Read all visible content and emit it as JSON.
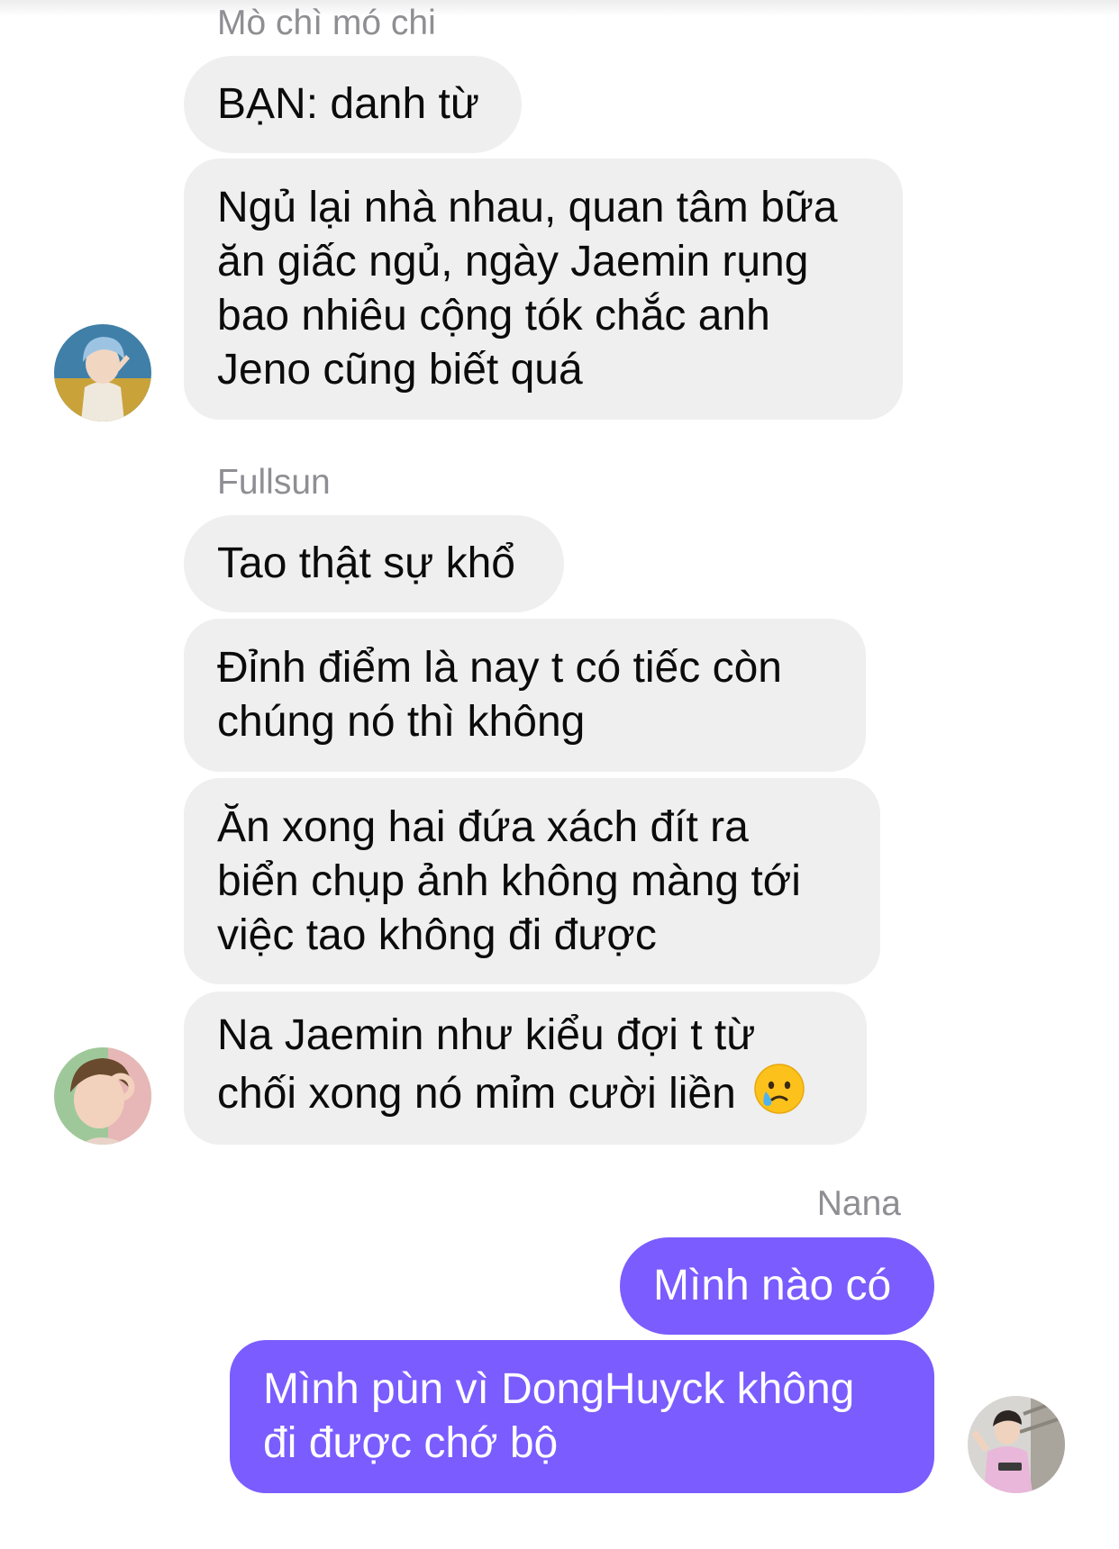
{
  "conversation": {
    "groups": [
      {
        "sender": "Mò chì mó chi",
        "messages": [
          {
            "lines": [
              "BẠN: danh từ"
            ]
          },
          {
            "lines": [
              "Ngủ lại nhà nhau, quan tâm bữa",
              "ăn giấc ngủ, ngày Jaemin rụng",
              "bao nhiêu cộng tók chắc anh",
              "Jeno cũng biết quá"
            ]
          }
        ]
      },
      {
        "sender": "Fullsun",
        "messages": [
          {
            "lines": [
              "Tao thật sự khổ"
            ]
          },
          {
            "lines": [
              "Đỉnh điểm là nay t có tiếc còn",
              "chúng nó thì không"
            ]
          },
          {
            "lines": [
              "Ăn xong hai đứa xách đít ra",
              "biển chụp ảnh không màng tới",
              "việc tao không đi được"
            ]
          },
          {
            "lines": [
              "Na Jaemin như kiểu đợi t từ",
              "chối xong nó mỉm cười liền"
            ],
            "emoji": "crying-face"
          }
        ]
      },
      {
        "sender": "Nana",
        "messages": [
          {
            "lines": [
              "Mình nào có"
            ]
          },
          {
            "lines": [
              "Mình pùn vì DongHuyck không",
              "đi được chớ bộ"
            ]
          }
        ]
      }
    ]
  },
  "colors": {
    "incoming_bubble": "#efefef",
    "outgoing_bubble": "#7b5cff",
    "sender_name": "#8e8e93",
    "background": "#ffffff"
  }
}
